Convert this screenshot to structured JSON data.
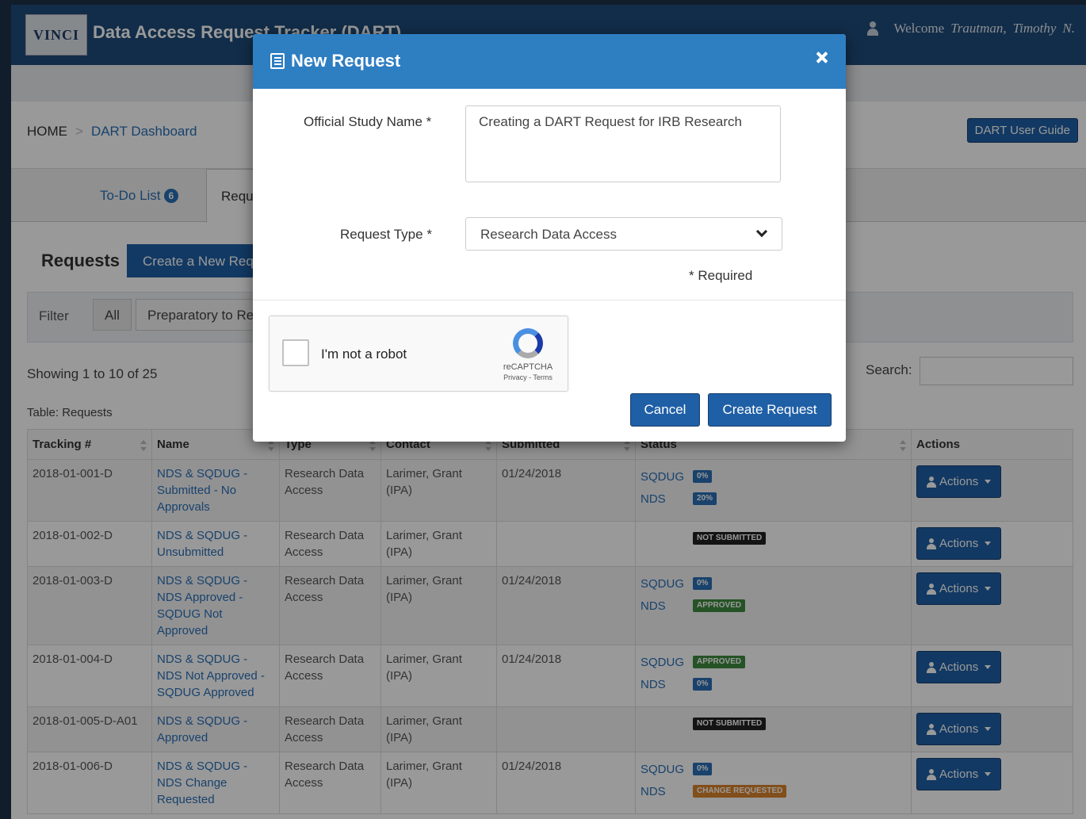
{
  "navbar": {
    "logo_text": "VINCI",
    "title": "Data Access Request Tracker (DART)",
    "welcome_label": "Welcome",
    "user_last": "Trautman,",
    "user_first": "Timothy",
    "user_initial": "N."
  },
  "breadcrumb": {
    "home": "HOME",
    "separator": ">",
    "current": "DART Dashboard"
  },
  "guide_button": "DART User Guide",
  "tabs": [
    {
      "label": "To-Do List",
      "badge": "6"
    },
    {
      "label": "Requests"
    }
  ],
  "requests": {
    "title": "Requests",
    "create_button": "Create a New Request",
    "filter_label": "Filter",
    "filters": [
      "All",
      "Preparatory to Research"
    ],
    "showing": "Showing 1 to 10 of 25",
    "search_label": "Search:",
    "table_caption": "Table: Requests",
    "columns": [
      "Tracking #",
      "Name",
      "Type",
      "Contact",
      "Submitted",
      "Status",
      "Actions"
    ],
    "actions_label": "Actions",
    "rows": [
      {
        "tracking": "2018-01-001-D",
        "name": "NDS & SQDUG - Submitted - No Approvals",
        "type": "Research Data Access",
        "contact": "Larimer, Grant (IPA)",
        "submitted": "01/24/2018",
        "status": [
          {
            "label": "SQDUG",
            "chip": "0%",
            "color": "#2a6fb5"
          },
          {
            "label": "NDS",
            "chip": "20%",
            "color": "#2a6fb5"
          }
        ]
      },
      {
        "tracking": "2018-01-002-D",
        "name": "NDS & SQDUG - Unsubmitted",
        "type": "Research Data Access",
        "contact": "Larimer, Grant (IPA)",
        "submitted": "",
        "status": [
          {
            "label": "",
            "chip": "NOT SUBMITTED",
            "color": "#222222"
          }
        ]
      },
      {
        "tracking": "2018-01-003-D",
        "name": "NDS & SQDUG - NDS Approved - SQDUG Not Approved",
        "type": "Research Data Access",
        "contact": "Larimer, Grant (IPA)",
        "submitted": "01/24/2018",
        "status": [
          {
            "label": "SQDUG",
            "chip": "0%",
            "color": "#2a6fb5"
          },
          {
            "label": "NDS",
            "chip": "APPROVED",
            "color": "#3f8a3f"
          }
        ]
      },
      {
        "tracking": "2018-01-004-D",
        "name": "NDS & SQDUG - NDS Not Approved - SQDUG Approved",
        "type": "Research Data Access",
        "contact": "Larimer, Grant (IPA)",
        "submitted": "01/24/2018",
        "status": [
          {
            "label": "SQDUG",
            "chip": "APPROVED",
            "color": "#3f8a3f"
          },
          {
            "label": "NDS",
            "chip": "0%",
            "color": "#2a6fb5"
          }
        ]
      },
      {
        "tracking": "2018-01-005-D-A01",
        "name": "NDS & SQDUG - Approved",
        "type": "Research Data Access",
        "contact": "Larimer, Grant (IPA)",
        "submitted": "",
        "status": [
          {
            "label": "",
            "chip": "NOT SUBMITTED",
            "color": "#222222"
          }
        ]
      },
      {
        "tracking": "2018-01-006-D",
        "name": "NDS & SQDUG - NDS Change Requested",
        "type": "Research Data Access",
        "contact": "Larimer, Grant (IPA)",
        "submitted": "01/24/2018",
        "status": [
          {
            "label": "SQDUG",
            "chip": "0%",
            "color": "#2a6fb5"
          },
          {
            "label": "NDS",
            "chip": "CHANGE REQUESTED",
            "color": "#d9822b"
          }
        ]
      }
    ]
  },
  "modal": {
    "title": "New Request",
    "study_label": "Official Study Name *",
    "study_value": "Creating a DART Request for IRB Research",
    "type_label": "Request Type *",
    "type_value": "Research Data Access",
    "required_note": "* Required",
    "captcha_label": "I'm not a robot",
    "captcha_brand": "reCAPTCHA",
    "captcha_terms": "Privacy - Terms",
    "cancel": "Cancel",
    "create": "Create Request"
  }
}
